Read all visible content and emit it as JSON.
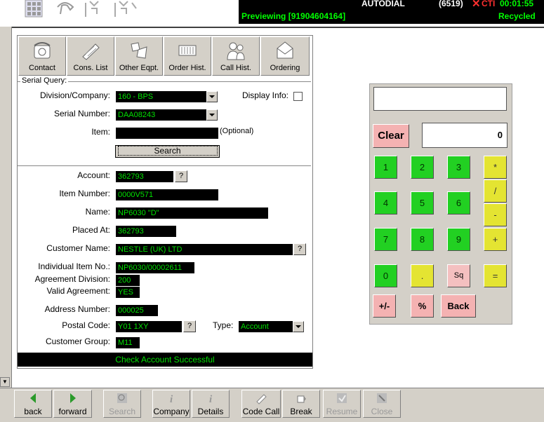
{
  "cti": {
    "autodial": "AUTODIAL",
    "count": "(6519)",
    "brand": "CTI",
    "timer": "00:01:55",
    "previewing": "Previewing [91904604164]",
    "recycled": "Recycled"
  },
  "toolbar": {
    "contact": "Contact",
    "cons_list": "Cons. List",
    "other_eqpt": "Other Eqpt.",
    "order_hist": "Order Hist.",
    "call_hist": "Call Hist.",
    "ordering": "Ordering"
  },
  "serial_query": {
    "legend": "Serial Query:",
    "division_label": "Division/Company:",
    "division_value": "160 - BPS",
    "display_info_label": "Display Info:",
    "serial_label": "Serial Number:",
    "serial_value": "DAA08243",
    "item_label": "Item:",
    "item_value": "",
    "optional": "(Optional)",
    "search_button": "Search"
  },
  "details": {
    "account_label": "Account:",
    "account_value": "362793",
    "item_number_label": "Item Number:",
    "item_number_value": "0000V571",
    "name_label": "Name:",
    "name_value": "NP6030 \"D\"",
    "placed_at_label": "Placed At:",
    "placed_at_value": "362793",
    "customer_name_label": "Customer Name:",
    "customer_name_value": "NESTLE (UK) LTD",
    "individual_item_label": "Individual Item No.:",
    "individual_item_value": "NP6030/00002611",
    "agreement_division_label": "Agreement Division:",
    "agreement_division_value": "200",
    "valid_agreement_label": "Valid Agreement:",
    "valid_agreement_value": "YES",
    "address_number_label": "Address Number:",
    "address_number_value": "000025",
    "postal_code_label": "Postal Code:",
    "postal_code_value": "Y01 1XY",
    "type_label": "Type:",
    "type_value": "Account",
    "customer_group_label": "Customer Group:",
    "customer_group_value": "M11",
    "question": "?"
  },
  "status": "Check Account Successful",
  "calculator": {
    "display_top": "",
    "display_value": "0",
    "clear": "Clear",
    "keys": [
      "1",
      "2",
      "3",
      "4",
      "5",
      "6",
      "7",
      "8",
      "9",
      "0"
    ],
    "dot": ".",
    "sq": "Sq",
    "plus_minus": "+/-",
    "percent": "%",
    "back": "Back",
    "ops": [
      "*",
      "/",
      "-",
      "+",
      "="
    ]
  },
  "bottom": {
    "back": "back",
    "forward": "forward",
    "search": "Search",
    "company": "Company",
    "details": "Details",
    "code_call": "Code Call",
    "break": "Break",
    "resume": "Resume",
    "close": "Close"
  },
  "colors": {
    "field_bg": "#000000",
    "field_text": "#00e000",
    "cti_red": "#ff3030",
    "cti_green": "#00ff00",
    "calc_green": "#22d022",
    "calc_yellow": "#e4e432",
    "calc_pink": "#f4b2b2"
  }
}
